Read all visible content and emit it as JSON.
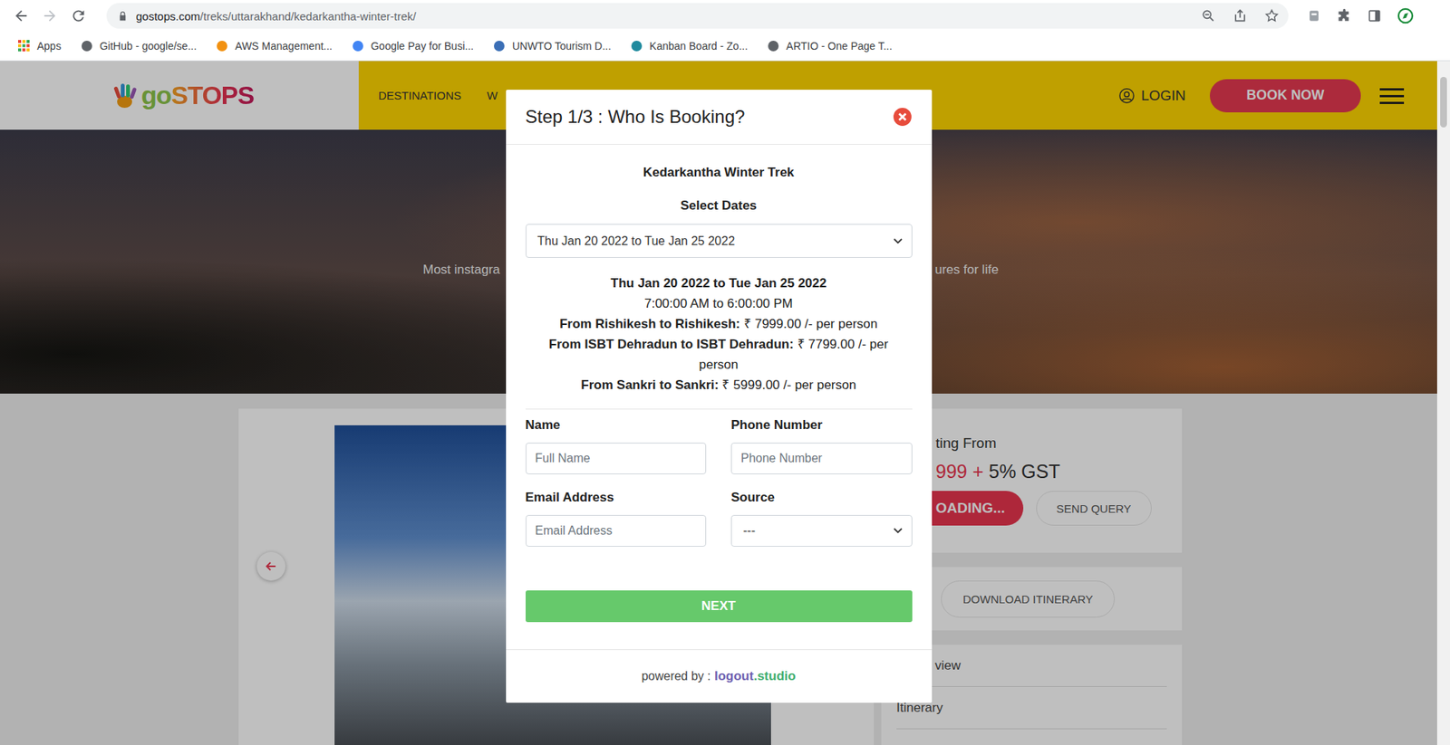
{
  "browser": {
    "url_host": "gostops.com",
    "url_path": "/treks/uttarakhand/kedarkantha-winter-trek/",
    "bookmarks": [
      {
        "label": "Apps",
        "color": "#4285f4"
      },
      {
        "label": "GitHub - google/se...",
        "color": "#5f6368"
      },
      {
        "label": "AWS Management...",
        "color": "#f29111"
      },
      {
        "label": "Google Pay for Busi...",
        "color": "#4285f4"
      },
      {
        "label": "UNWTO Tourism D...",
        "color": "#3b6fb6"
      },
      {
        "label": "Kanban Board - Zo...",
        "color": "#1f8a9e"
      },
      {
        "label": "ARTIO - One Page T...",
        "color": "#5f6368"
      }
    ]
  },
  "site": {
    "logo_first": "go",
    "logo_second": "STOPS",
    "nav": [
      "DESTINATIONS",
      "W"
    ],
    "login": "LOGIN",
    "book_now": "BOOK NOW",
    "hero_fragments": [
      "Most instagra",
      "ures for life"
    ],
    "price_label": "ting From",
    "price": "999",
    "price_plus": "+",
    "price_tax": "5% GST",
    "loading_button": "OADING...",
    "send_query": "SEND QUERY",
    "download": "DOWNLOAD ITINERARY",
    "tabs": [
      "view",
      "Itinerary"
    ]
  },
  "modal": {
    "title": "Step 1/3 : Who Is Booking?",
    "trek_name": "Kedarkantha Winter Trek",
    "dates_label": "Select Dates",
    "selected_date": "Thu Jan 20 2022 to Tue Jan 25 2022",
    "date_heading": "Thu Jan 20 2022 to Tue Jan 25 2022",
    "time": "7:00:00 AM to 6:00:00 PM",
    "prices": [
      {
        "route": "From Rishikesh to Rishikesh:",
        "price": "₹ 7999.00 /- per person"
      },
      {
        "route": "From ISBT Dehradun to ISBT Dehradun:",
        "price": "₹ 7799.00 /- per person"
      },
      {
        "route": "From Sankri to Sankri:",
        "price": "₹ 5999.00 /- per person"
      }
    ],
    "fields": [
      {
        "label": "Name",
        "kind": "input",
        "placeholder": "Full Name"
      },
      {
        "label": "Phone Number",
        "kind": "input",
        "placeholder": "Phone Number"
      },
      {
        "label": "Email Address",
        "kind": "input",
        "placeholder": "Email Address"
      },
      {
        "label": "Source",
        "kind": "select",
        "placeholder": "---"
      }
    ],
    "next": "NEXT",
    "footer_prefix": "powered by :",
    "footer_brand": "logout",
    "footer_suffix": ".studio"
  }
}
